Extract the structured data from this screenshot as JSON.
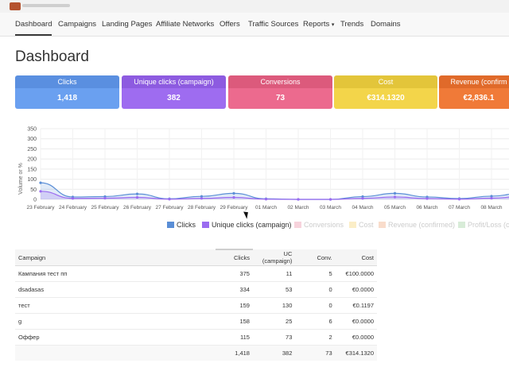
{
  "nav": {
    "items": [
      "Dashboard",
      "Campaigns",
      "Landing Pages",
      "Affiliate Networks",
      "Offers",
      "Traffic Sources",
      "Reports",
      "Trends",
      "Domains"
    ],
    "reports_caret": "▾"
  },
  "page": {
    "title": "Dashboard"
  },
  "cards": {
    "clicks": {
      "label": "Clicks",
      "value": "1,418"
    },
    "unique": {
      "label": "Unique clicks (campaign)",
      "value": "382"
    },
    "conversions": {
      "label": "Conversions",
      "value": "73"
    },
    "cost": {
      "label": "Cost",
      "value": "€314.1320"
    },
    "revenue": {
      "label": "Revenue (confirm",
      "value": "€2,836.1"
    }
  },
  "chart_data": {
    "type": "area",
    "ylabel": "Volume or %",
    "ylim": [
      0,
      350
    ],
    "y_ticks": [
      "350",
      "300",
      "250",
      "200",
      "150",
      "100",
      "50",
      "0"
    ],
    "categories": [
      "23 February",
      "24 February",
      "25 February",
      "26 February",
      "27 February",
      "28 February",
      "29 February",
      "01 March",
      "02 March",
      "03 March",
      "04 March",
      "05 March",
      "06 March",
      "07 March",
      "08 March"
    ],
    "series": [
      {
        "name": "Clicks",
        "color": "#5a8ed6",
        "values": [
          82,
          12,
          14,
          27,
          3,
          15,
          30,
          3,
          0,
          0,
          14,
          30,
          12,
          4,
          16,
          32
        ]
      },
      {
        "name": "Unique clicks (campaign)",
        "color": "#9b6cf0",
        "values": [
          40,
          5,
          6,
          10,
          1,
          5,
          10,
          1,
          0,
          0,
          5,
          12,
          4,
          1,
          6,
          15
        ]
      }
    ],
    "legend": [
      {
        "label": "Clicks",
        "color": "#5a8ed6",
        "active": true
      },
      {
        "label": "Unique clicks (campaign)",
        "color": "#9b6cf0",
        "active": true
      },
      {
        "label": "Conversions",
        "color": "#f7d3dc",
        "active": false
      },
      {
        "label": "Cost",
        "color": "#fbeec7",
        "active": false
      },
      {
        "label": "Revenue (confirmed)",
        "color": "#f9dccb",
        "active": false
      },
      {
        "label": "Profit/Loss (c",
        "color": "#d8ecd8",
        "active": false
      }
    ]
  },
  "table": {
    "headers": [
      "Campaign",
      "Clicks",
      "UC (campaign)",
      "Conv.",
      "Cost"
    ],
    "rows": [
      [
        "Кампания тест пп",
        "375",
        "11",
        "5",
        "€100.0000"
      ],
      [
        "dsadasas",
        "334",
        "53",
        "0",
        "€0.0000"
      ],
      [
        "тест",
        "159",
        "130",
        "0",
        "€0.1197"
      ],
      [
        "g",
        "158",
        "25",
        "6",
        "€0.0000"
      ],
      [
        "Оффер",
        "115",
        "73",
        "2",
        "€0.0000"
      ]
    ],
    "totals": [
      "",
      "1,418",
      "382",
      "73",
      "€314.1320"
    ]
  }
}
